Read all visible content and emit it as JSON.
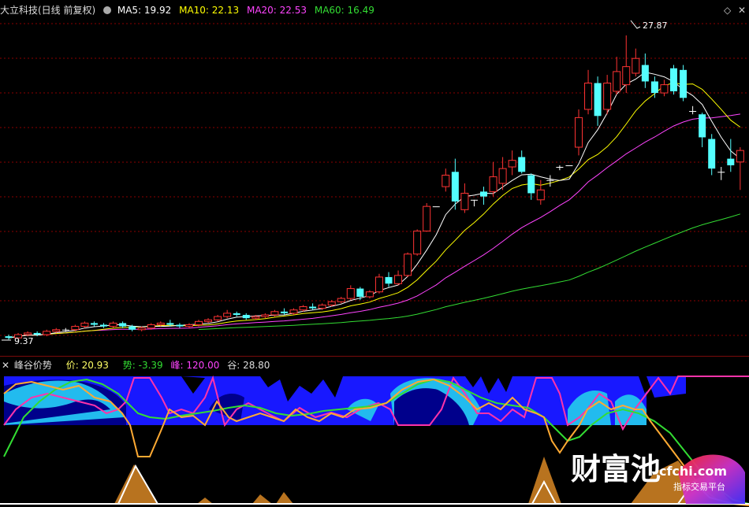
{
  "colors": {
    "up": "#ff3333",
    "down": "#54ffff",
    "ma5": "#ffffff",
    "ma10": "#ffff00",
    "ma20": "#ff44ff",
    "ma60": "#33dd33",
    "bg": "#000000",
    "grid": "#8b0000",
    "blue": "#1818ff",
    "navy": "#00008b",
    "cyan": "#22bbee",
    "gold": "#ffaa33",
    "brown": "#b8731f"
  },
  "main": {
    "title": "大立科技(日线 前复权)",
    "ma5": "MA5: 19.92",
    "ma10": "MA10: 22.13",
    "ma20": "MA20: 22.53",
    "ma60": "MA60: 16.49",
    "high_label": "27.87",
    "low_label": "9.37"
  },
  "sub": {
    "name": "峰谷价势",
    "price": "价: 20.93",
    "trend": "势: -3.39",
    "peak": "峰: 120.00",
    "valley": "谷: 28.80"
  },
  "watermark": {
    "brand": "财富池",
    "url": "cfchi.com",
    "tagline": "指标交易平台"
  },
  "chart_data": {
    "type": "candlestick",
    "price_range": [
      9.37,
      27.87
    ],
    "candles": [
      [
        9.6,
        9.5,
        9.7,
        9.4
      ],
      [
        9.5,
        9.7,
        9.8,
        9.4
      ],
      [
        9.7,
        9.8,
        9.9,
        9.6
      ],
      [
        9.8,
        9.7,
        9.9,
        9.6
      ],
      [
        9.7,
        9.9,
        10.0,
        9.6
      ],
      [
        9.9,
        10.0,
        10.1,
        9.8
      ],
      [
        10.0,
        10.0,
        10.1,
        9.9
      ],
      [
        10.0,
        10.2,
        10.3,
        9.9
      ],
      [
        10.2,
        10.4,
        10.5,
        10.1
      ],
      [
        10.4,
        10.3,
        10.5,
        10.2
      ],
      [
        10.3,
        10.2,
        10.4,
        10.1
      ],
      [
        10.2,
        10.4,
        10.5,
        10.1
      ],
      [
        10.4,
        10.2,
        10.5,
        10.1
      ],
      [
        10.2,
        10.0,
        10.3,
        9.9
      ],
      [
        10.0,
        10.1,
        10.2,
        9.9
      ],
      [
        10.1,
        10.3,
        10.4,
        10.0
      ],
      [
        10.3,
        10.4,
        10.5,
        10.2
      ],
      [
        10.4,
        10.3,
        10.6,
        10.2
      ],
      [
        10.3,
        10.2,
        10.4,
        10.1
      ],
      [
        10.2,
        10.3,
        10.4,
        10.1
      ],
      [
        10.3,
        10.5,
        10.6,
        10.2
      ],
      [
        10.5,
        10.6,
        10.7,
        10.4
      ],
      [
        10.6,
        10.8,
        10.9,
        10.5
      ],
      [
        10.8,
        11.0,
        11.2,
        10.7
      ],
      [
        11.0,
        10.9,
        11.1,
        10.8
      ],
      [
        10.9,
        10.7,
        11.0,
        10.6
      ],
      [
        10.7,
        10.8,
        10.9,
        10.6
      ],
      [
        10.8,
        10.9,
        11.0,
        10.7
      ],
      [
        10.9,
        11.1,
        11.2,
        10.8
      ],
      [
        11.1,
        11.0,
        11.3,
        10.9
      ],
      [
        11.0,
        11.2,
        11.3,
        10.9
      ],
      [
        11.2,
        11.4,
        11.5,
        11.1
      ],
      [
        11.4,
        11.3,
        11.6,
        11.2
      ],
      [
        11.3,
        11.5,
        11.6,
        11.2
      ],
      [
        11.5,
        11.7,
        11.8,
        11.4
      ],
      [
        11.7,
        11.9,
        12.0,
        11.6
      ],
      [
        11.9,
        12.5,
        12.7,
        11.8
      ],
      [
        12.5,
        12.0,
        12.6,
        11.8
      ],
      [
        12.0,
        12.3,
        12.4,
        11.9
      ],
      [
        12.3,
        13.2,
        13.4,
        12.2
      ],
      [
        13.2,
        12.8,
        13.5,
        12.6
      ],
      [
        12.8,
        13.3,
        13.6,
        12.7
      ],
      [
        13.3,
        14.6,
        14.7,
        13.2
      ],
      [
        14.6,
        16.0,
        16.1,
        14.5
      ],
      [
        16.0,
        17.5,
        17.7,
        16.0
      ],
      [
        17.5,
        17.5,
        17.5,
        17.5
      ],
      [
        18.7,
        19.4,
        19.8,
        18.4
      ],
      [
        19.6,
        17.8,
        20.4,
        17.3
      ],
      [
        17.3,
        18.3,
        18.9,
        17.1
      ],
      [
        17.9,
        17.9,
        17.9,
        17.5
      ],
      [
        18.4,
        18.1,
        18.7,
        17.6
      ],
      [
        18.4,
        19.3,
        20.2,
        18.1
      ],
      [
        18.9,
        19.8,
        20.5,
        18.5
      ],
      [
        19.9,
        20.3,
        20.9,
        19.4
      ],
      [
        20.5,
        19.6,
        20.9,
        19.5
      ],
      [
        19.4,
        18.3,
        19.5,
        17.9
      ],
      [
        17.9,
        18.5,
        19.1,
        17.6
      ],
      [
        19.1,
        19.1,
        19.4,
        18.7
      ],
      [
        19.9,
        19.9,
        20.0,
        19.7
      ],
      [
        20.0,
        20.0,
        20.0,
        20.0
      ],
      [
        21.1,
        22.9,
        23.4,
        20.6
      ],
      [
        23.4,
        25.0,
        25.8,
        23.1
      ],
      [
        25.0,
        23.0,
        25.4,
        22.4
      ],
      [
        23.4,
        25.0,
        25.5,
        23.1
      ],
      [
        24.5,
        25.7,
        26.6,
        24.3
      ],
      [
        24.9,
        26.0,
        27.9,
        24.4
      ],
      [
        25.6,
        26.5,
        27.1,
        25.4
      ],
      [
        26.1,
        25.1,
        26.8,
        24.7
      ],
      [
        25.1,
        24.4,
        25.4,
        24.1
      ],
      [
        24.4,
        24.9,
        25.2,
        24.2
      ],
      [
        25.9,
        24.5,
        26.1,
        24.3
      ],
      [
        25.8,
        24.1,
        26.1,
        23.9
      ],
      [
        23.3,
        23.3,
        23.6,
        23.1
      ],
      [
        23.1,
        21.7,
        23.2,
        21.1
      ],
      [
        21.6,
        19.8,
        21.9,
        19.4
      ],
      [
        19.6,
        19.6,
        19.9,
        19.1
      ],
      [
        20.4,
        20.0,
        21.6,
        19.6
      ],
      [
        20.2,
        20.9,
        21.1,
        18.5
      ]
    ]
  }
}
